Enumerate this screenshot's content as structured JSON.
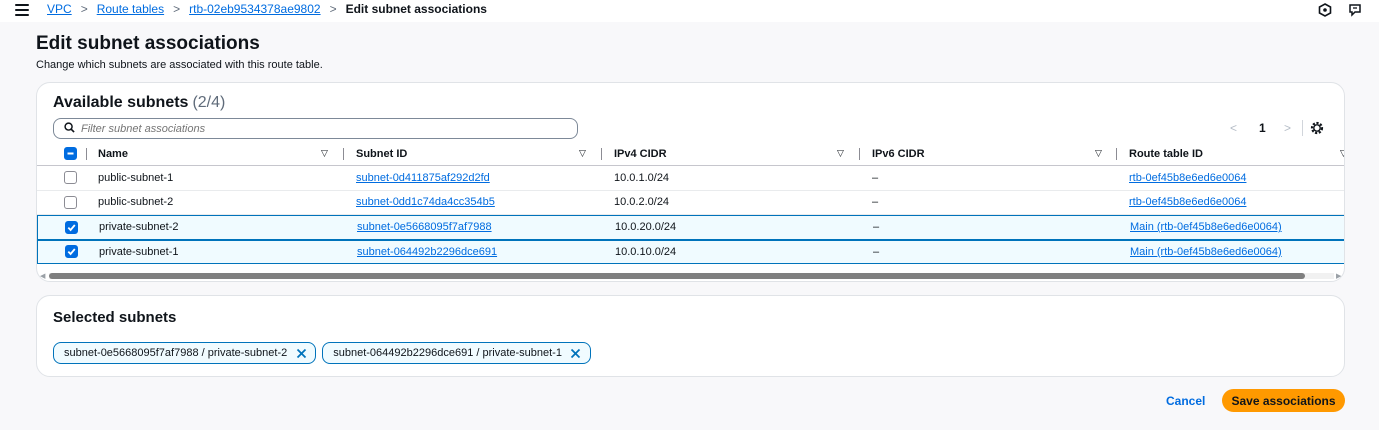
{
  "breadcrumb": {
    "items": [
      "VPC",
      "Route tables",
      "rtb-02eb9534378ae9802"
    ],
    "current": "Edit subnet associations",
    "separator": ">"
  },
  "page": {
    "title": "Edit subnet associations",
    "description": "Change which subnets are associated with this route table."
  },
  "available": {
    "title": "Available subnets",
    "count": "(2/4)",
    "filter_placeholder": "Filter subnet associations",
    "pager": {
      "prev": "<",
      "page": "1",
      "next": ">"
    },
    "columns": [
      "Name",
      "Subnet ID",
      "IPv4 CIDR",
      "IPv6 CIDR",
      "Route table ID"
    ],
    "rows": [
      {
        "checked": false,
        "name": "public-subnet-1",
        "subnet_id": "subnet-0d411875af292d2fd",
        "ipv4": "10.0.1.0/24",
        "ipv6": "–",
        "route_table": "rtb-0ef45b8e6ed6e0064"
      },
      {
        "checked": false,
        "name": "public-subnet-2",
        "subnet_id": "subnet-0dd1c74da4cc354b5",
        "ipv4": "10.0.2.0/24",
        "ipv6": "–",
        "route_table": "rtb-0ef45b8e6ed6e0064"
      },
      {
        "checked": true,
        "name": "private-subnet-2",
        "subnet_id": "subnet-0e5668095f7af7988",
        "ipv4": "10.0.20.0/24",
        "ipv6": "–",
        "route_table": "Main (rtb-0ef45b8e6ed6e0064)"
      },
      {
        "checked": true,
        "name": "private-subnet-1",
        "subnet_id": "subnet-064492b2296dce691",
        "ipv4": "10.0.10.0/24",
        "ipv6": "–",
        "route_table": "Main (rtb-0ef45b8e6ed6e0064)"
      }
    ]
  },
  "selected": {
    "title": "Selected subnets",
    "tokens": [
      "subnet-0e5668095f7af7988 / private-subnet-2",
      "subnet-064492b2296dce691 / private-subnet-1"
    ]
  },
  "actions": {
    "cancel": "Cancel",
    "save": "Save associations"
  },
  "colors": {
    "link": "#006ce0",
    "primary_button": "#ff9900",
    "selected_row_bg": "#f0fbff",
    "selected_border": "#0073bb"
  },
  "icons": {
    "menu": "hamburger-icon",
    "top_right": [
      "info-hexagon-icon",
      "feedback-icon"
    ],
    "filter": "search-icon",
    "settings": "gear-icon",
    "token_remove": "close-icon",
    "sort": "caret-down-icon"
  }
}
